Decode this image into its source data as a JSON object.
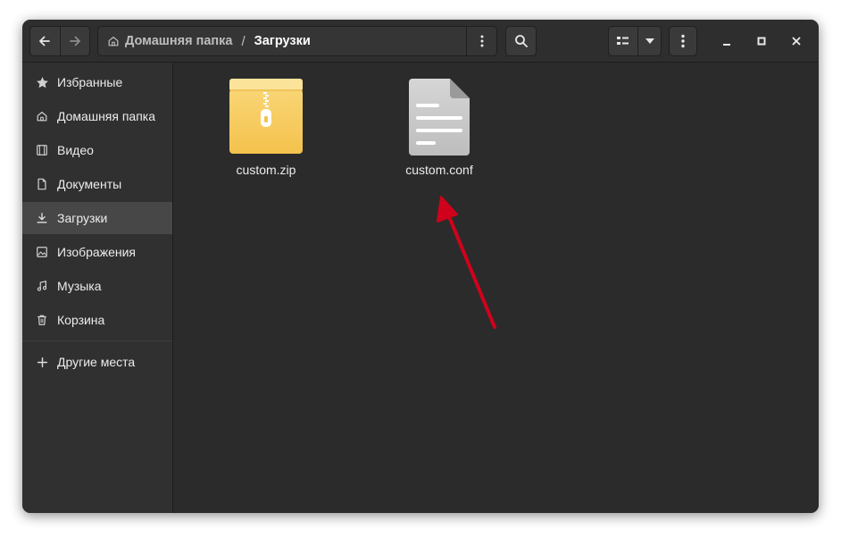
{
  "window": {
    "breadcrumb": {
      "home_label": "Домашняя папка",
      "separator": "/",
      "current_label": "Загрузки"
    }
  },
  "icons": {
    "back": "arrow-left-icon",
    "forward": "arrow-right-icon",
    "home": "home-icon",
    "path_menu": "kebab-menu-icon",
    "search": "search-icon",
    "view_mode": "list-view-icon",
    "view_dropdown": "chevron-down-icon",
    "main_menu": "kebab-menu-icon",
    "minimize": "minimize-icon",
    "maximize": "maximize-icon",
    "close": "close-icon"
  },
  "sidebar": {
    "items": [
      {
        "label": "Избранные",
        "icon": "star-icon",
        "active": false
      },
      {
        "label": "Домашняя папка",
        "icon": "home-icon",
        "active": false
      },
      {
        "label": "Видео",
        "icon": "film-icon",
        "active": false
      },
      {
        "label": "Документы",
        "icon": "document-icon",
        "active": false
      },
      {
        "label": "Загрузки",
        "icon": "download-icon",
        "active": true
      },
      {
        "label": "Изображения",
        "icon": "image-icon",
        "active": false
      },
      {
        "label": "Музыка",
        "icon": "music-icon",
        "active": false
      },
      {
        "label": "Корзина",
        "icon": "trash-icon",
        "active": false
      }
    ],
    "other_places": {
      "label": "Другие места",
      "icon": "plus-icon"
    }
  },
  "files": [
    {
      "name": "custom.zip",
      "icon": "zip-archive-icon"
    },
    {
      "name": "custom.conf",
      "icon": "text-file-icon"
    }
  ],
  "colors": {
    "window_bg": "#2c2c2c",
    "sidebar_active": "#474747",
    "zip_icon": "#f6c95a",
    "annotation_arrow": "#d0021b"
  }
}
